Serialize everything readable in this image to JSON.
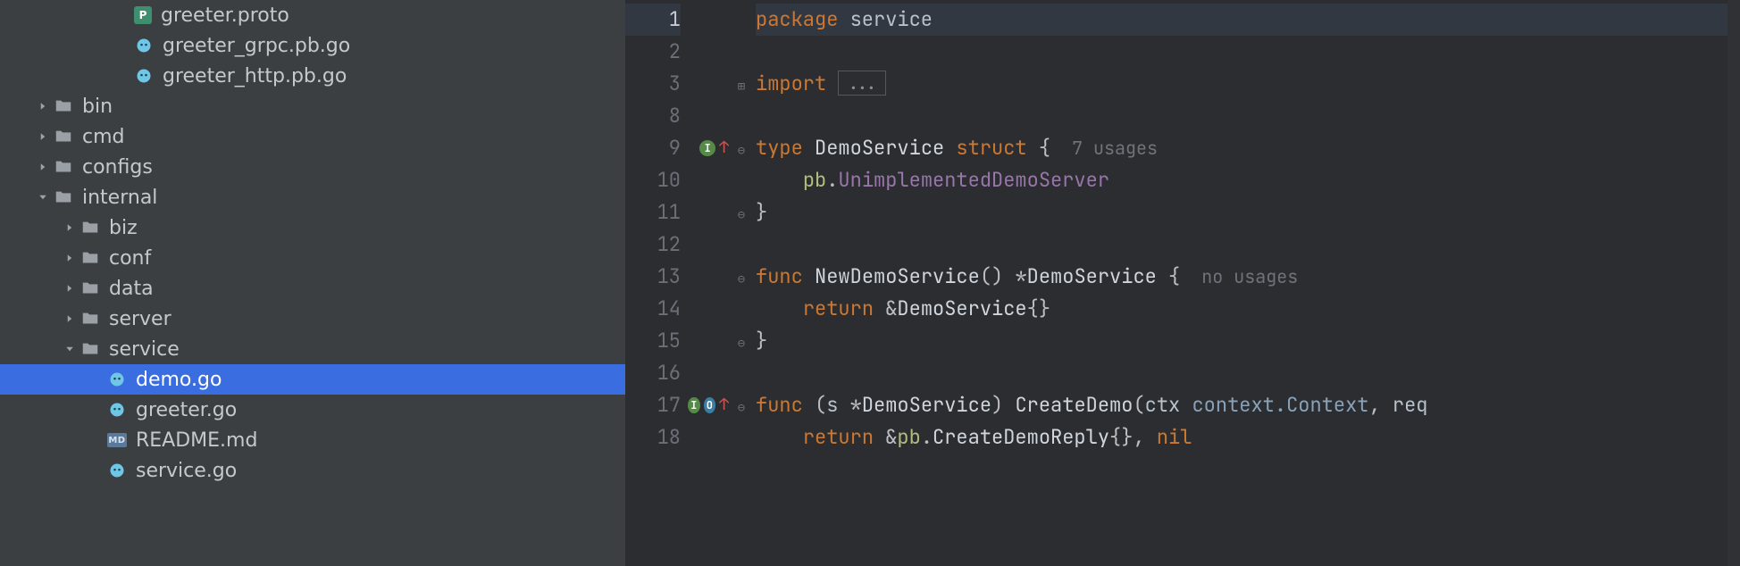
{
  "tree": {
    "items": [
      {
        "indent": 4,
        "chev": "",
        "icon": "proto",
        "label": "greeter.proto"
      },
      {
        "indent": 4,
        "chev": "",
        "icon": "go",
        "label": "greeter_grpc.pb.go"
      },
      {
        "indent": 4,
        "chev": "",
        "icon": "go",
        "label": "greeter_http.pb.go"
      },
      {
        "indent": 1,
        "chev": "right",
        "icon": "folder",
        "label": "bin"
      },
      {
        "indent": 1,
        "chev": "right",
        "icon": "folder",
        "label": "cmd"
      },
      {
        "indent": 1,
        "chev": "right",
        "icon": "folder",
        "label": "configs"
      },
      {
        "indent": 1,
        "chev": "down",
        "icon": "folder",
        "label": "internal"
      },
      {
        "indent": 2,
        "chev": "right",
        "icon": "folder",
        "label": "biz"
      },
      {
        "indent": 2,
        "chev": "right",
        "icon": "folder",
        "label": "conf"
      },
      {
        "indent": 2,
        "chev": "right",
        "icon": "folder",
        "label": "data"
      },
      {
        "indent": 2,
        "chev": "right",
        "icon": "folder",
        "label": "server"
      },
      {
        "indent": 2,
        "chev": "down",
        "icon": "folder",
        "label": "service"
      },
      {
        "indent": 3,
        "chev": "",
        "icon": "go",
        "label": "demo.go",
        "selected": true
      },
      {
        "indent": 3,
        "chev": "",
        "icon": "go",
        "label": "greeter.go"
      },
      {
        "indent": 3,
        "chev": "",
        "icon": "md",
        "label": "README.md"
      },
      {
        "indent": 3,
        "chev": "",
        "icon": "go",
        "label": "service.go"
      }
    ]
  },
  "editor": {
    "line_numbers": [
      "1",
      "2",
      "3",
      "8",
      "9",
      "10",
      "11",
      "12",
      "13",
      "14",
      "15",
      "16",
      "17",
      "18"
    ],
    "gutter_marks": [
      "",
      "",
      "",
      "",
      [
        "impl",
        "up"
      ],
      "",
      "",
      "",
      "",
      "",
      "",
      "",
      [
        "impl",
        "ovr",
        "up"
      ],
      ""
    ],
    "fold": [
      "",
      "",
      "plus",
      "",
      "open",
      "",
      "close",
      "",
      "open",
      "",
      "close",
      "",
      "open",
      ""
    ],
    "hints": {
      "struct": "7 usages",
      "func_new": "no usages"
    },
    "tokens": {
      "package": "package",
      "service": "service",
      "import": "import",
      "type": "type",
      "DemoService": "DemoService",
      "struct": "struct",
      "obrace": "{",
      "pb": "pb",
      "dot": ".",
      "UnimplementedDemoServer": "UnimplementedDemoServer",
      "cbrace": "}",
      "func": "func",
      "NewDemoService": "NewDemoService",
      "parens": "()",
      "star": "*",
      "return": "return",
      "amp": "&",
      "emptybraces": "{}",
      "s": "s",
      "CreateDemo": "CreateDemo",
      "ctx": "ctx",
      "context_Context": "context.Context",
      "req": "req",
      "CreateDemoReply": "CreateDemoReply",
      "comma": ",",
      "nil": "nil",
      "ellipsis": "..."
    }
  }
}
